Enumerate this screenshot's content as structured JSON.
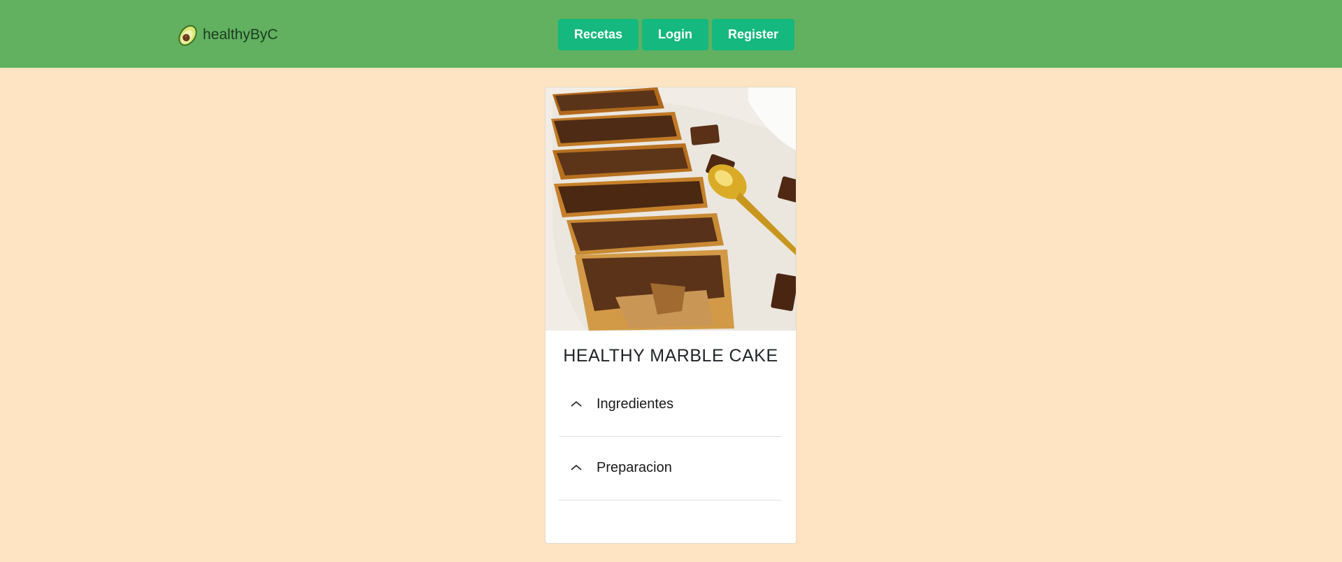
{
  "navbar": {
    "brand": "healthyByC",
    "buttons": [
      "Recetas",
      "Login",
      "Register"
    ]
  },
  "recipe": {
    "title": "HEALTHY MARBLE CAKE",
    "sections": [
      "Ingredientes",
      "Preparacion"
    ]
  },
  "colors": {
    "navbar": "#61B160",
    "page_background": "#FFE4C4",
    "button": "#15B87F"
  }
}
